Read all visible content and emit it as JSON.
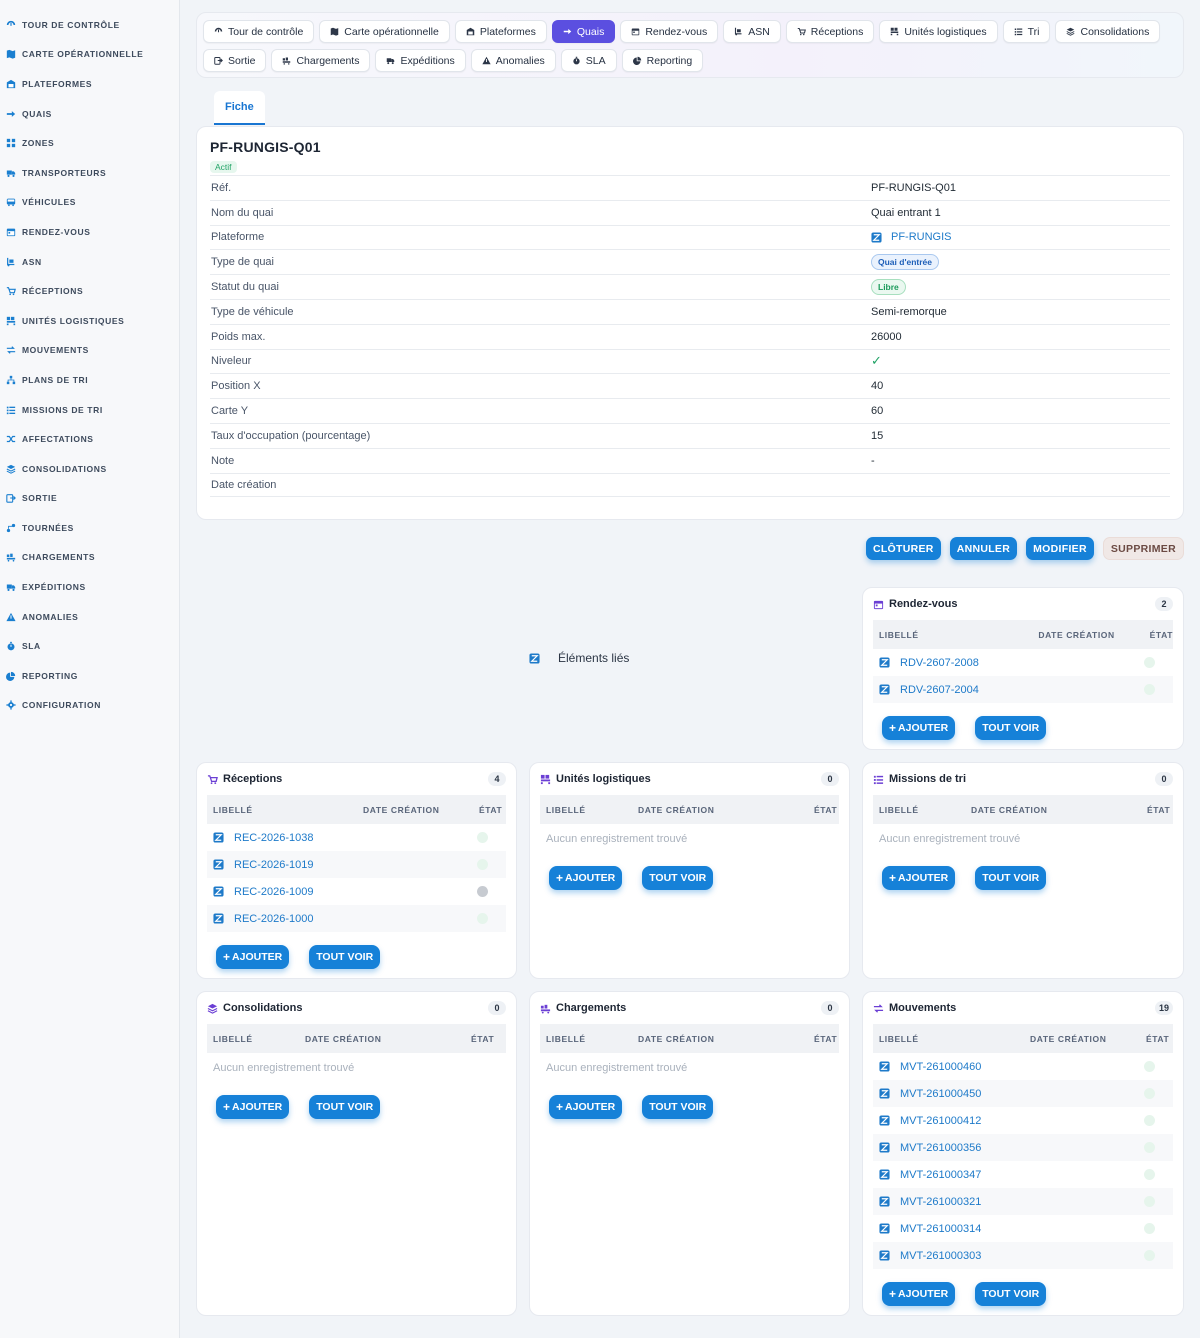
{
  "sidebar": {
    "items": [
      {
        "label": "TOUR DE CONTRÔLE",
        "icon": "gauge-icon"
      },
      {
        "label": "CARTE OPÉRATIONNELLE",
        "icon": "map-icon"
      },
      {
        "label": "PLATEFORMES",
        "icon": "warehouse-icon"
      },
      {
        "label": "QUAIS",
        "icon": "dock-icon"
      },
      {
        "label": "ZONES",
        "icon": "grid-icon"
      },
      {
        "label": "TRANSPORTEURS",
        "icon": "truck-icon"
      },
      {
        "label": "VÉHICULES",
        "icon": "bus-icon"
      },
      {
        "label": "RENDEZ-VOUS",
        "icon": "calendar-icon"
      },
      {
        "label": "ASN",
        "icon": "dolly-icon"
      },
      {
        "label": "RÉCEPTIONS",
        "icon": "receive-icon"
      },
      {
        "label": "UNITÉS LOGISTIQUES",
        "icon": "pallet-icon"
      },
      {
        "label": "MOUVEMENTS",
        "icon": "arrows-icon"
      },
      {
        "label": "PLANS DE TRI",
        "icon": "sitemap-icon"
      },
      {
        "label": "MISSIONS DE TRI",
        "icon": "list-icon"
      },
      {
        "label": "AFFECTATIONS",
        "icon": "shuffle-icon"
      },
      {
        "label": "CONSOLIDATIONS",
        "icon": "layers-icon"
      },
      {
        "label": "SORTIE",
        "icon": "exit-icon"
      },
      {
        "label": "TOURNÉES",
        "icon": "route-icon"
      },
      {
        "label": "CHARGEMENTS",
        "icon": "loading-icon"
      },
      {
        "label": "EXPÉDITIONS",
        "icon": "shipping-icon"
      },
      {
        "label": "ANOMALIES",
        "icon": "warning-icon"
      },
      {
        "label": "SLA",
        "icon": "stopwatch-icon"
      },
      {
        "label": "REPORTING",
        "icon": "chart-icon"
      },
      {
        "label": "CONFIGURATION",
        "icon": "gear-icon"
      }
    ]
  },
  "topnav": {
    "items": [
      {
        "label": "Tour de contrôle",
        "icon": "gauge-icon",
        "active": false
      },
      {
        "label": "Carte opérationnelle",
        "icon": "map-icon",
        "active": false
      },
      {
        "label": "Plateformes",
        "icon": "warehouse-icon",
        "active": false
      },
      {
        "label": "Quais",
        "icon": "dock-icon",
        "active": true
      },
      {
        "label": "Rendez-vous",
        "icon": "calendar-icon",
        "active": false
      },
      {
        "label": "ASN",
        "icon": "dolly-icon",
        "active": false
      },
      {
        "label": "Réceptions",
        "icon": "receive-icon",
        "active": false
      },
      {
        "label": "Unités logistiques",
        "icon": "pallet-icon",
        "active": false
      },
      {
        "label": "Tri",
        "icon": "list-icon",
        "active": false
      },
      {
        "label": "Consolidations",
        "icon": "layers-icon",
        "active": false
      },
      {
        "label": "Sortie",
        "icon": "exit-icon",
        "active": false
      },
      {
        "label": "Chargements",
        "icon": "loading-icon",
        "active": false
      },
      {
        "label": "Expéditions",
        "icon": "shipping-icon",
        "active": false
      },
      {
        "label": "Anomalies",
        "icon": "warning-icon",
        "active": false
      },
      {
        "label": "SLA",
        "icon": "stopwatch-icon",
        "active": false
      },
      {
        "label": "Reporting",
        "icon": "chart-icon",
        "active": false
      }
    ]
  },
  "tabs": {
    "fiche": "Fiche"
  },
  "detail": {
    "title": "PF-RUNGIS-Q01",
    "status": "Actif",
    "fields": {
      "ref": {
        "label": "Réf.",
        "value": "PF-RUNGIS-Q01"
      },
      "nom": {
        "label": "Nom du quai",
        "value": "Quai entrant 1"
      },
      "plateforme": {
        "label": "Plateforme",
        "value": "PF-RUNGIS"
      },
      "type_quai": {
        "label": "Type de quai",
        "value": "Quai d'entrée"
      },
      "statut": {
        "label": "Statut du quai",
        "value": "Libre"
      },
      "type_vehicule": {
        "label": "Type de véhicule",
        "value": "Semi-remorque"
      },
      "poids": {
        "label": "Poids max.",
        "value": "26000"
      },
      "niveleur": {
        "label": "Niveleur",
        "value": "✓"
      },
      "pos_x": {
        "label": "Position X",
        "value": "40"
      },
      "carte_y": {
        "label": "Carte Y",
        "value": "60"
      },
      "taux": {
        "label": "Taux d'occupation (pourcentage)",
        "value": "15"
      },
      "note": {
        "label": "Note",
        "value": "-"
      },
      "date": {
        "label": "Date création",
        "value": ""
      }
    }
  },
  "actions": {
    "cloturer": "CLÔTURER",
    "annuler": "ANNULER",
    "modifier": "MODIFIER",
    "supprimer": "SUPPRIMER"
  },
  "lies": {
    "label": "Éléments liés"
  },
  "common": {
    "col_libelle": "LIBELLÉ",
    "col_date": "DATE CRÉATION",
    "col_etat": "ÉTAT",
    "empty": "Aucun enregistrement trouvé",
    "add": "AJOUTER",
    "all": "TOUT VOIR"
  },
  "cards": {
    "rdv": {
      "title": "Rendez-vous",
      "count": "2",
      "rows": [
        "RDV-2607-2008",
        "RDV-2607-2004"
      ]
    },
    "receptions": {
      "title": "Réceptions",
      "count": "4",
      "rows": [
        "REC-2026-1038",
        "REC-2026-1019",
        "REC-2026-1009",
        "REC-2026-1000"
      ]
    },
    "unites": {
      "title": "Unités logistiques",
      "count": "0",
      "rows": []
    },
    "missions": {
      "title": "Missions de tri",
      "count": "0",
      "rows": []
    },
    "consolidations": {
      "title": "Consolidations",
      "count": "0",
      "rows": []
    },
    "chargements": {
      "title": "Chargements",
      "count": "0",
      "rows": []
    },
    "mouvements": {
      "title": "Mouvements",
      "count": "19",
      "rows": [
        "MVT-261000460",
        "MVT-261000450",
        "MVT-261000412",
        "MVT-261000356",
        "MVT-261000347",
        "MVT-261000321",
        "MVT-261000314",
        "MVT-261000303"
      ]
    }
  },
  "colors": {
    "accent": "#1681d8",
    "active_nav": "#5b4fe0",
    "link": "#1e7ac9",
    "success": "#21a366",
    "card_icon": "#6b3fd4"
  }
}
